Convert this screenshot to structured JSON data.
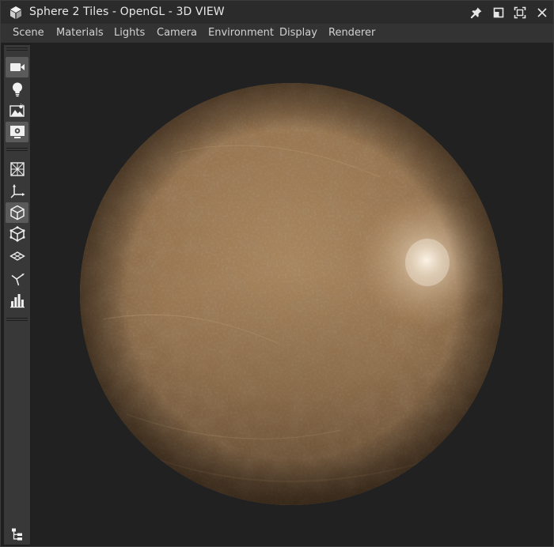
{
  "window": {
    "title": "Sphere 2 Tiles - OpenGL - 3D VIEW",
    "icons": [
      "app-cube-icon",
      "pin-icon",
      "restore-icon",
      "maximize-icon",
      "close-icon"
    ]
  },
  "menu": {
    "items": [
      "Scene",
      "Materials",
      "Lights",
      "Camera",
      "Environment",
      "Display",
      "Renderer"
    ]
  },
  "toolbar": {
    "group1": [
      "camera-icon",
      "light-bulb-icon",
      "environment-image-icon",
      "display-settings-icon"
    ],
    "group2": [
      "wireframe-cube-icon",
      "axis-gizmo-icon",
      "solid-cube-icon",
      "cube-edges-icon",
      "layers-plane-icon",
      "normals-icon",
      "histogram-icon"
    ],
    "active": [
      "camera-icon",
      "display-settings-icon",
      "solid-cube-icon"
    ],
    "bottom": "scene-tree-icon"
  },
  "viewport": {
    "object": "sphere",
    "material_color": "#9a7a56",
    "background": "#212121"
  },
  "colors": {
    "titlebar": "#2b2b2b",
    "menubar": "#333333",
    "toolbar": "#383838",
    "text": "#e8e8e8"
  }
}
